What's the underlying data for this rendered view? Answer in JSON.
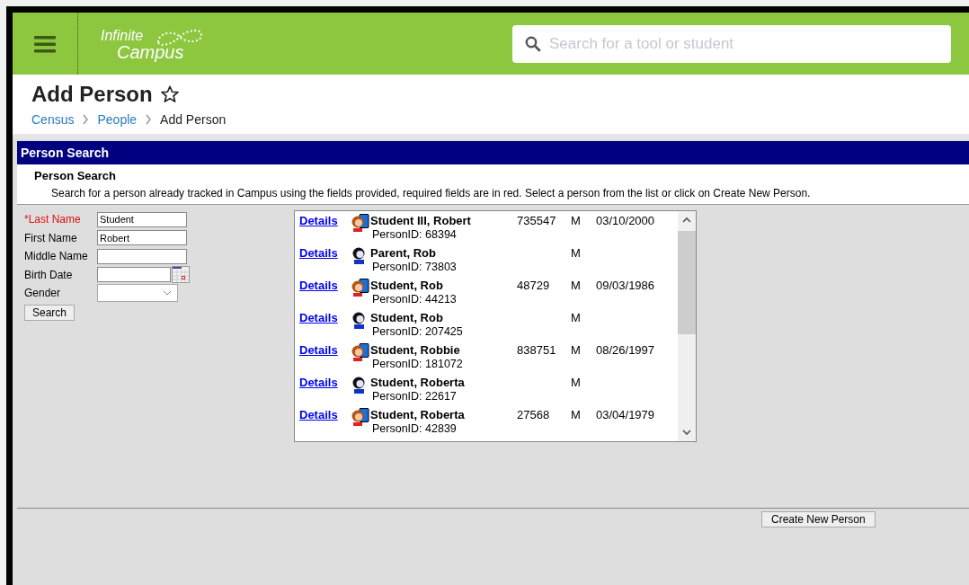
{
  "header": {
    "logo_line_1": "Infinite",
    "logo_line_2": "Campus",
    "search": {
      "placeholder": "Search for a tool or student"
    }
  },
  "page": {
    "title": "Add Person",
    "breadcrumbs": [
      {
        "label": "Census",
        "link": true
      },
      {
        "label": "People",
        "link": true
      },
      {
        "label": "Add Person",
        "link": false
      }
    ]
  },
  "panel": {
    "title": "Person Search",
    "subtitle": "Person Search",
    "instructions": "Search for a person already tracked in Campus using the fields provided, required fields are in red. Select a person from the list or click on Create New Person."
  },
  "form": {
    "fields": [
      {
        "label": "*Last Name",
        "required": true,
        "kind": "text",
        "value": "Student"
      },
      {
        "label": "First Name",
        "required": false,
        "kind": "text",
        "value": "Robert"
      },
      {
        "label": "Middle Name",
        "required": false,
        "kind": "text"
      },
      {
        "label": "Birth Date",
        "required": false,
        "kind": "date"
      },
      {
        "label": "Gender",
        "required": false,
        "kind": "select"
      }
    ],
    "search_button": "Search"
  },
  "results": [
    {
      "link": "Details",
      "kind": "student",
      "name": "Student III, Robert",
      "person_id": "PersonID: 68394",
      "number": "735547",
      "gender": "M",
      "birth_date": "03/10/2000"
    },
    {
      "link": "Details",
      "kind": "person",
      "name": "Parent, Rob",
      "person_id": "PersonID: 73803",
      "gender": "M"
    },
    {
      "link": "Details",
      "kind": "student",
      "name": "Student, Rob",
      "person_id": "PersonID: 44213",
      "number": "48729",
      "gender": "M",
      "birth_date": "09/03/1986"
    },
    {
      "link": "Details",
      "kind": "person",
      "name": "Student, Rob",
      "person_id": "PersonID: 207425",
      "gender": "M"
    },
    {
      "link": "Details",
      "kind": "student",
      "name": "Student, Robbie",
      "person_id": "PersonID: 181072",
      "number": "838751",
      "gender": "M",
      "birth_date": "08/26/1997"
    },
    {
      "link": "Details",
      "kind": "person",
      "name": "Student, Roberta",
      "person_id": "PersonID: 22617",
      "gender": "M"
    },
    {
      "link": "Details",
      "kind": "student",
      "name": "Student, Roberta",
      "person_id": "PersonID: 42839",
      "number": "27568",
      "gender": "M",
      "birth_date": "03/04/1979"
    }
  ],
  "create_button": "Create New Person"
}
